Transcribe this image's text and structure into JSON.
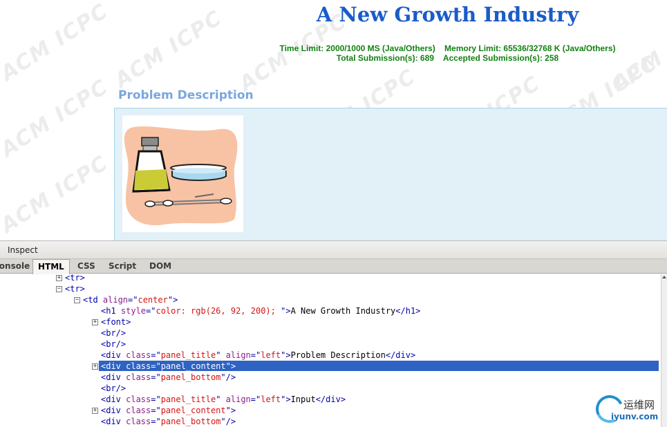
{
  "watermark": {
    "text": "ACM ICPC"
  },
  "problem": {
    "title": "A New Growth Industry",
    "time_limit": "Time Limit: 2000/1000 MS (Java/Others)",
    "memory_limit": "Memory Limit: 65536/32768 K (Java/Others)",
    "total_submissions": "Total Submission(s): 689",
    "accepted_submissions": "Accepted Submission(s): 258",
    "panel_title": "Problem Description"
  },
  "devtools": {
    "inspect_label": "Inspect",
    "tabs": [
      {
        "label": "Console"
      },
      {
        "label": "HTML",
        "active": true
      },
      {
        "label": "CSS"
      },
      {
        "label": "Script"
      },
      {
        "label": "DOM"
      }
    ],
    "tree_rows": [
      {
        "toggle": "+",
        "parts": [
          [
            "t",
            "<tr>"
          ]
        ]
      },
      {
        "toggle": "-",
        "parts": [
          [
            "t",
            "<tr>"
          ]
        ]
      },
      {
        "toggle": "-",
        "parts": [
          [
            "t",
            "<td "
          ],
          [
            "a",
            "align"
          ],
          [
            "t",
            "=\""
          ],
          [
            "v",
            "center"
          ],
          [
            "t",
            "\">"
          ]
        ]
      },
      {
        "toggle": "",
        "parts": [
          [
            "t",
            "<h1 "
          ],
          [
            "a",
            "style"
          ],
          [
            "t",
            "=\""
          ],
          [
            "v",
            "color: rgb(26, 92, 200); "
          ],
          [
            "t",
            "\">"
          ],
          [
            "x",
            "A New Growth Industry"
          ],
          [
            "t",
            "</h1>"
          ]
        ]
      },
      {
        "toggle": "+",
        "parts": [
          [
            "t",
            "<font>"
          ]
        ]
      },
      {
        "toggle": "",
        "parts": [
          [
            "t",
            "<br/>"
          ]
        ]
      },
      {
        "toggle": "",
        "parts": [
          [
            "t",
            "<br/>"
          ]
        ]
      },
      {
        "toggle": "",
        "parts": [
          [
            "t",
            "<div "
          ],
          [
            "a",
            "class"
          ],
          [
            "t",
            "=\""
          ],
          [
            "v",
            "panel_title"
          ],
          [
            "t",
            "\" "
          ],
          [
            "a",
            "align"
          ],
          [
            "t",
            "=\""
          ],
          [
            "v",
            "left"
          ],
          [
            "t",
            "\">"
          ],
          [
            "x",
            "Problem Description"
          ],
          [
            "t",
            "</div>"
          ]
        ]
      },
      {
        "toggle": "+",
        "selected": true,
        "parts": [
          [
            "t",
            "<div "
          ],
          [
            "a",
            "class"
          ],
          [
            "t",
            "=\""
          ],
          [
            "v",
            "panel_content"
          ],
          [
            "t",
            "\">"
          ]
        ]
      },
      {
        "toggle": "",
        "parts": [
          [
            "t",
            "<div "
          ],
          [
            "a",
            "class"
          ],
          [
            "t",
            "=\""
          ],
          [
            "v",
            "panel_bottom"
          ],
          [
            "t",
            "\"/>"
          ]
        ]
      },
      {
        "toggle": "",
        "parts": [
          [
            "t",
            "<br/>"
          ]
        ]
      },
      {
        "toggle": "",
        "parts": [
          [
            "t",
            "<div "
          ],
          [
            "a",
            "class"
          ],
          [
            "t",
            "=\""
          ],
          [
            "v",
            "panel_title"
          ],
          [
            "t",
            "\" "
          ],
          [
            "a",
            "align"
          ],
          [
            "t",
            "=\""
          ],
          [
            "v",
            "left"
          ],
          [
            "t",
            "\">"
          ],
          [
            "x",
            "Input"
          ],
          [
            "t",
            "</div>"
          ]
        ]
      },
      {
        "toggle": "+",
        "parts": [
          [
            "t",
            "<div "
          ],
          [
            "a",
            "class"
          ],
          [
            "t",
            "=\""
          ],
          [
            "v",
            "panel_content"
          ],
          [
            "t",
            "\">"
          ]
        ]
      },
      {
        "toggle": "",
        "parts": [
          [
            "t",
            "<div "
          ],
          [
            "a",
            "class"
          ],
          [
            "t",
            "=\""
          ],
          [
            "v",
            "panel_bottom"
          ],
          [
            "t",
            "\"/>"
          ]
        ]
      }
    ]
  },
  "site_logo": {
    "cn": "运维网",
    "en": "iyunv.com"
  },
  "colors": {
    "title_blue": "#1a5cc8",
    "limits_green": "#128012",
    "panel_title_blue": "#7aa6e0",
    "panel_bg": "#e2f0f8",
    "selection_blue": "#2e63c3"
  }
}
